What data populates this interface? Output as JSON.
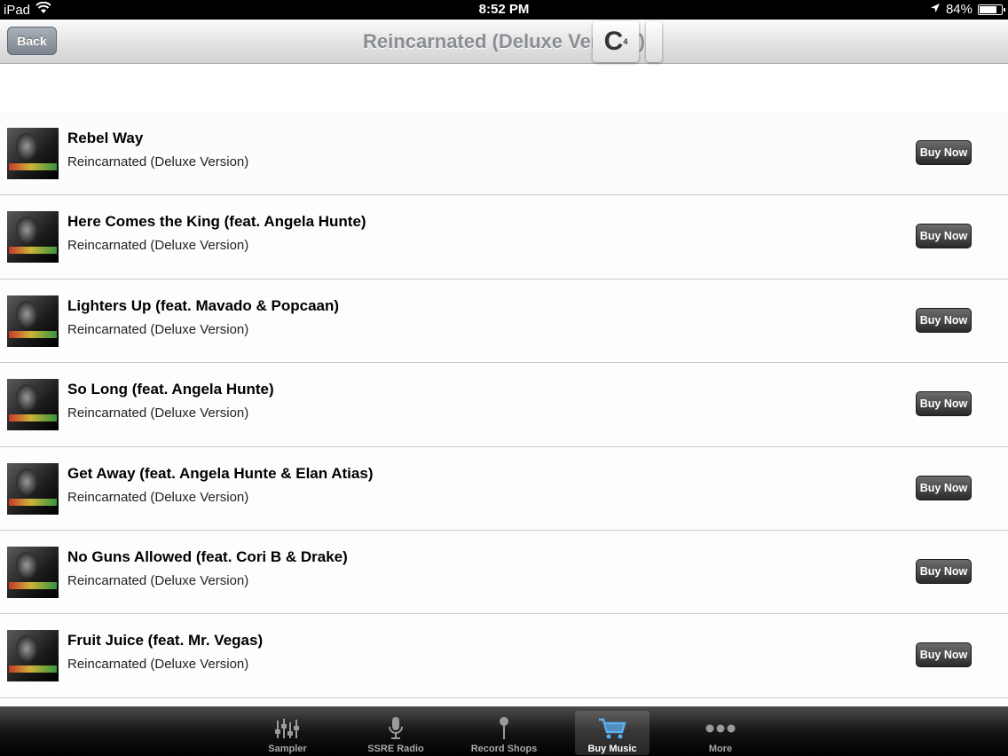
{
  "status_bar": {
    "device": "iPad",
    "time": "8:52 PM",
    "battery": "84%",
    "battery_level": 0.84
  },
  "nav": {
    "back_label": "Back",
    "title": "Reincarnated (Deluxe Version)",
    "overlay_letter": "C",
    "overlay_superscript": "4"
  },
  "tracks": [
    {
      "title": "Rebel Way",
      "album": "Reincarnated (Deluxe Version)",
      "button": "Buy Now"
    },
    {
      "title": "Here Comes the King (feat. Angela Hunte)",
      "album": "Reincarnated (Deluxe Version)",
      "button": "Buy Now"
    },
    {
      "title": "Lighters Up (feat. Mavado & Popcaan)",
      "album": "Reincarnated (Deluxe Version)",
      "button": "Buy Now"
    },
    {
      "title": "So Long (feat. Angela Hunte)",
      "album": "Reincarnated (Deluxe Version)",
      "button": "Buy Now"
    },
    {
      "title": "Get Away (feat. Angela Hunte & Elan Atias)",
      "album": "Reincarnated (Deluxe Version)",
      "button": "Buy Now"
    },
    {
      "title": "No Guns Allowed (feat. Cori B & Drake)",
      "album": "Reincarnated (Deluxe Version)",
      "button": "Buy Now"
    },
    {
      "title": "Fruit Juice (feat. Mr. Vegas)",
      "album": "Reincarnated (Deluxe Version)",
      "button": "Buy Now"
    }
  ],
  "tabs": [
    {
      "label": "Sampler",
      "icon": "mixer-icon",
      "active": false
    },
    {
      "label": "SSRE Radio",
      "icon": "microphone-icon",
      "active": false
    },
    {
      "label": "Record Shops",
      "icon": "map-pin-icon",
      "active": false
    },
    {
      "label": "Buy Music",
      "icon": "cart-icon",
      "active": true
    },
    {
      "label": "More",
      "icon": "more-icon",
      "active": false
    }
  ],
  "colors": {
    "nav_title": "#8a8e94",
    "buy_button": "#2a2a2a",
    "tab_active_icon": "#5ab0f0"
  }
}
